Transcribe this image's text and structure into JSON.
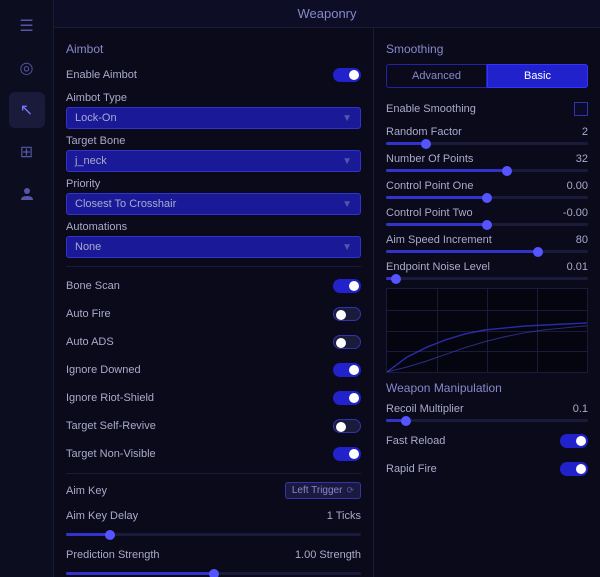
{
  "title": "Weaponry",
  "sidebar": {
    "icons": [
      {
        "name": "menu-icon",
        "symbol": "☰",
        "active": false
      },
      {
        "name": "crosshair-icon",
        "symbol": "◎",
        "active": false
      },
      {
        "name": "cursor-icon",
        "symbol": "↖",
        "active": true
      },
      {
        "name": "plus-icon",
        "symbol": "⊞",
        "active": false
      },
      {
        "name": "person-icon",
        "symbol": "👤",
        "active": false
      }
    ]
  },
  "left": {
    "aimbot_section": "Aimbot",
    "enable_aimbot_label": "Enable Aimbot",
    "enable_aimbot_on": true,
    "aimbot_type_label": "Aimbot Type",
    "aimbot_type_value": "Lock-On",
    "target_bone_label": "Target Bone",
    "target_bone_value": "j_neck",
    "priority_label": "Priority",
    "priority_value": "Closest To Crosshair",
    "automations_label": "Automations",
    "automations_value": "None",
    "bone_scan_label": "Bone Scan",
    "bone_scan_on": true,
    "auto_fire_label": "Auto Fire",
    "auto_fire_on": false,
    "auto_ads_label": "Auto ADS",
    "auto_ads_on": false,
    "ignore_downed_label": "Ignore Downed",
    "ignore_downed_on": true,
    "ignore_riotshield_label": "Ignore Riot-Shield",
    "ignore_riotshield_on": true,
    "target_selfrevive_label": "Target Self-Revive",
    "target_selfrevive_on": false,
    "target_nonvisible_label": "Target Non-Visible",
    "target_nonvisible_on": true,
    "aim_key_label": "Aim Key",
    "aim_key_value": "Left Trigger",
    "aim_key_delay_label": "Aim Key Delay",
    "aim_key_delay_value": "1 Ticks",
    "aim_key_delay_pct": 15,
    "prediction_strength_label": "Prediction Strength",
    "prediction_strength_value": "1.00 Strength",
    "prediction_strength_pct": 50
  },
  "right": {
    "smoothing_section": "Smoothing",
    "tab_advanced": "Advanced",
    "tab_basic": "Basic",
    "enable_smoothing_label": "Enable Smoothing",
    "enable_smoothing_on": false,
    "random_factor_label": "Random Factor",
    "random_factor_value": "2",
    "random_factor_pct": 20,
    "num_points_label": "Number Of Points",
    "num_points_value": "32",
    "num_points_pct": 60,
    "control_point_one_label": "Control Point One",
    "control_point_one_value": "0.00",
    "control_point_one_pct": 50,
    "control_point_two_label": "Control Point Two",
    "control_point_two_value": "-0.00",
    "control_point_two_pct": 50,
    "aim_speed_label": "Aim Speed Increment",
    "aim_speed_value": "80",
    "aim_speed_pct": 75,
    "endpoint_noise_label": "Endpoint Noise Level",
    "endpoint_noise_value": "0.01",
    "endpoint_noise_pct": 5,
    "weapon_manipulation_section": "Weapon Manipulation",
    "recoil_multiplier_label": "Recoil Multiplier",
    "recoil_multiplier_value": "0.1",
    "recoil_multiplier_pct": 10,
    "fast_reload_label": "Fast Reload",
    "fast_reload_on": true,
    "rapid_fire_label": "Rapid Fire",
    "rapid_fire_on": true
  }
}
